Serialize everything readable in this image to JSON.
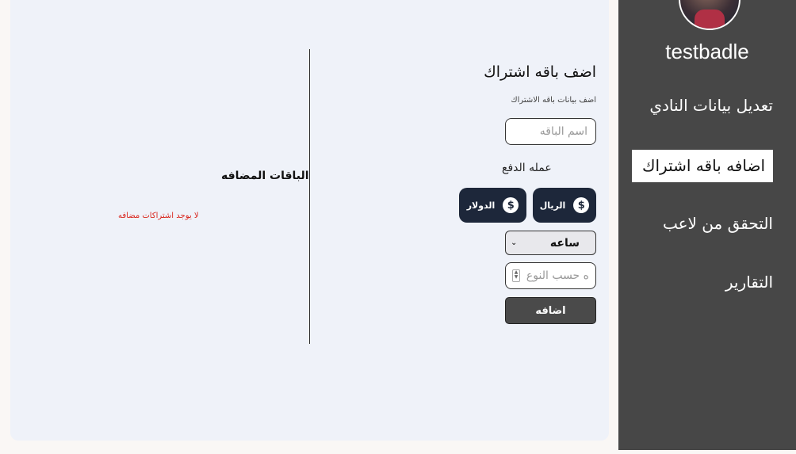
{
  "form": {
    "title": "اضف باقه اشتراك",
    "subtitle": "اضف بيانات باقه الاشتراك",
    "name_placeholder": "اسم الباقه",
    "currency_label": "عمله الدفع",
    "currencies": [
      "الريال",
      "الدولار"
    ],
    "currency_icon": "$",
    "duration_value": "ساعه",
    "quantity_placeholder": "ه حسب النوع",
    "submit_label": "اضافه"
  },
  "packages": {
    "title": "الباقات المضافه",
    "empty_message": "لا يوجد اشتراكات مضافه"
  },
  "sidebar": {
    "username": "testbadle",
    "items": [
      "تعديل بيانات النادي",
      "اضافه باقه اشتراك",
      "التحقق من لاعب",
      "التقارير"
    ],
    "active_index": 1
  },
  "colors": {
    "sidebar_bg": "#474747",
    "panel_bg": "#eff2f9",
    "currency_button": "#1d273a",
    "submit_button": "#4a4a4a",
    "empty_text": "#d9251d"
  }
}
